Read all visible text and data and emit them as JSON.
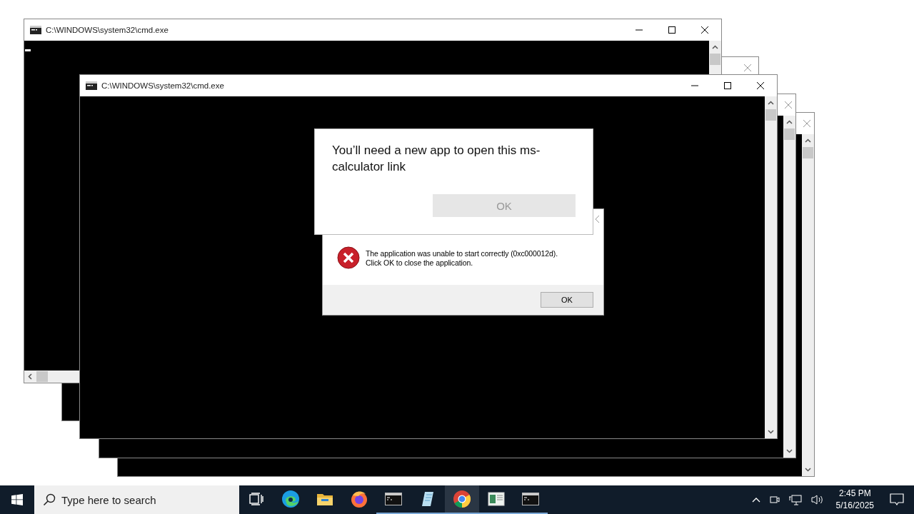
{
  "windows": [
    {
      "hscroll": false
    },
    {
      "hscroll": false
    },
    {
      "hscroll": false
    },
    {
      "title": "C:\\WINDOWS\\system32\\cmd.exe",
      "hscroll": true
    },
    {
      "title": "C:\\WINDOWS\\system32\\cmd.exe",
      "hscroll": false
    }
  ],
  "error_dialog": {
    "message": "The application was unable to start correctly (0xc000012d).\nClick OK to close the application.",
    "button": "OK"
  },
  "app_prompt": {
    "message": "You’ll need a new app to open this ms-calculator link",
    "button": "OK",
    "button_disabled": true
  },
  "taskbar": {
    "search": {
      "placeholder": "Type here to search"
    },
    "apps": [
      {
        "kind": "taskview",
        "running": false,
        "selected": false
      },
      {
        "kind": "edge",
        "running": false,
        "selected": false
      },
      {
        "kind": "explorer",
        "running": false,
        "selected": false
      },
      {
        "kind": "firefox",
        "running": false,
        "selected": false
      },
      {
        "kind": "cmd",
        "running": true,
        "selected": false
      },
      {
        "kind": "notepad",
        "running": true,
        "selected": false
      },
      {
        "kind": "chrome",
        "running": true,
        "selected": true
      },
      {
        "kind": "document",
        "running": true,
        "selected": false
      },
      {
        "kind": "cmd",
        "running": true,
        "selected": false
      }
    ],
    "time": "2:45 PM",
    "date": "5/16/2025"
  }
}
